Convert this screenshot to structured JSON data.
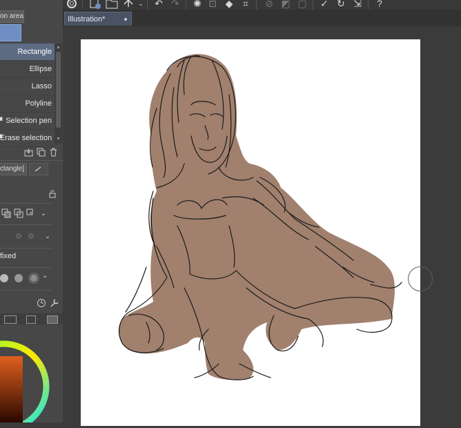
{
  "left_panel": {
    "tab_label": "on area]",
    "sub_tools": [
      {
        "label": "Rectangle",
        "selected": true
      },
      {
        "label": "Ellipse",
        "selected": false
      },
      {
        "label": "Lasso",
        "selected": false
      },
      {
        "label": "Polyline",
        "selected": false
      },
      {
        "label": "Selection pen",
        "selected": false
      },
      {
        "label": "Erase selection",
        "selected": false
      }
    ],
    "property_tab_label": "ctangle]",
    "fixed_label": "fixed",
    "colors": {
      "panel_bg": "#474747",
      "selected_bg": "#5d6b83",
      "accent_swatch": "#6f8fc4"
    }
  },
  "document": {
    "tab_title": "Illustration*"
  },
  "canvas": {
    "background": "#ffffff",
    "fill_color": "#a1806e",
    "line_color": "#1a1a1a"
  },
  "icons": {
    "toolbar": [
      "logo-icon",
      "new-canvas-icon",
      "open-folder-icon",
      "save-icon",
      "undo-icon",
      "redo-icon",
      "loading-icon",
      "transform-icon",
      "fill-icon",
      "crop-icon",
      "layer-icons",
      "selection-icons",
      "help-icon"
    ]
  }
}
